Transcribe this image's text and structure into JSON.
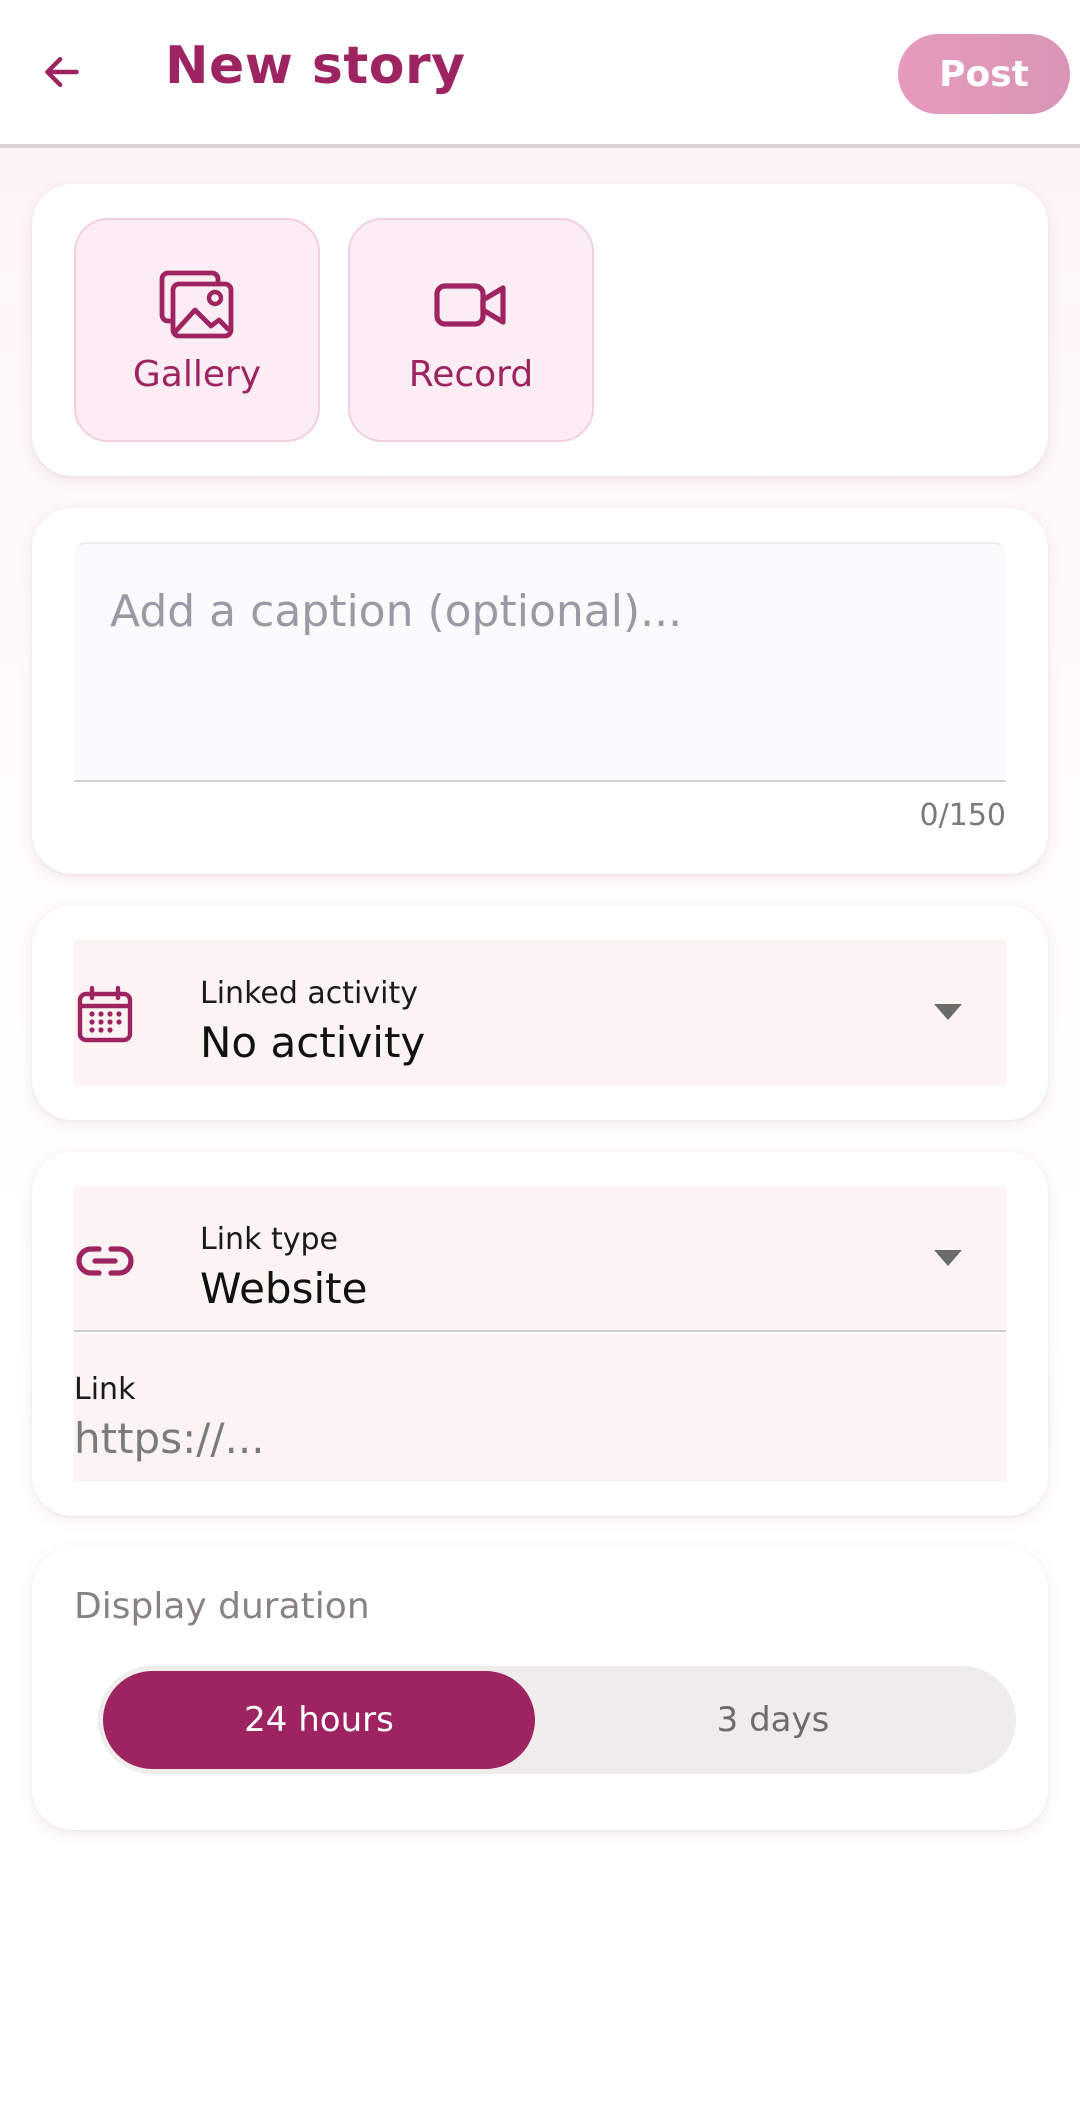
{
  "header": {
    "title": "New story",
    "post_label": "Post"
  },
  "media": {
    "gallery_label": "Gallery",
    "record_label": "Record"
  },
  "caption": {
    "placeholder": "Add a caption (optional)...",
    "value": "",
    "counter": "0/150"
  },
  "activity": {
    "label": "Linked activity",
    "value": "No activity"
  },
  "link": {
    "type_label": "Link type",
    "type_value": "Website",
    "link_label": "Link",
    "link_placeholder": "https://..."
  },
  "duration": {
    "label": "Display duration",
    "options": [
      "24 hours",
      "3 days"
    ],
    "selected": "24 hours"
  },
  "colors": {
    "accent": "#9e2461",
    "post_button": "#e69bbd",
    "media_tile": "#fcedf4",
    "field_bg": "#fbf4f2"
  },
  "icons": {
    "back": "arrow-left-icon",
    "gallery": "images-icon",
    "record": "video-camera-icon",
    "activity": "calendar-icon",
    "link_type": "link-icon",
    "dropdown": "caret-down-icon"
  }
}
